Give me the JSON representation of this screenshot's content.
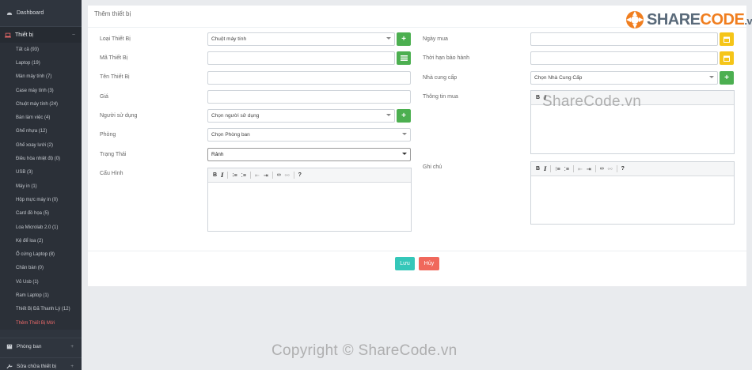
{
  "sidebar": {
    "dashboard": "Dashboard",
    "section": "Thiết bị",
    "items": [
      {
        "label": "Tất cả (93)"
      },
      {
        "label": "Laptop (19)"
      },
      {
        "label": "Màn máy tính (7)"
      },
      {
        "label": "Case máy tính (3)"
      },
      {
        "label": "Chuột máy tính (24)"
      },
      {
        "label": "Bàn làm việc (4)"
      },
      {
        "label": "Ghế nhựa (12)"
      },
      {
        "label": "Ghế xoay lưới (2)"
      },
      {
        "label": "Điều hòa nhiệt độ (0)"
      },
      {
        "label": "USB (3)"
      },
      {
        "label": "Máy in (1)"
      },
      {
        "label": "Hộp mực máy in (0)"
      },
      {
        "label": "Card đồ họa (5)"
      },
      {
        "label": "Loa Microlab 2.0 (1)"
      },
      {
        "label": "Kệ để loa (2)"
      },
      {
        "label": "Ổ cứng Laptop (8)"
      },
      {
        "label": "Chân bàn (0)"
      },
      {
        "label": "Vỏ Usb (1)"
      },
      {
        "label": "Ram Laptop (1)"
      },
      {
        "label": "Thiết Bị Đã Thanh Lý (12)"
      },
      {
        "label": "Thêm Thiết Bị Mới"
      }
    ],
    "footer": [
      {
        "label": "Phòng ban"
      },
      {
        "label": "Sửa chữa thiết bị"
      }
    ]
  },
  "form": {
    "title": "Thêm thiết bị",
    "loai_label": "Loại Thiết Bị",
    "loai_value": "Chuột máy tính",
    "ma_label": "Mã Thiết Bị",
    "ten_label": "Tên Thiết Bị",
    "gia_label": "Giá",
    "nguoi_label": "Người sử dụng",
    "nguoi_value": "Chọn người sử dụng",
    "phong_label": "Phòng",
    "phong_value": "Chọn Phòng ban",
    "trangthai_label": "Trạng Thái",
    "trangthai_value": "Rảnh",
    "cauhinh_label": "Cấu Hình",
    "ngaymua_label": "Ngày mua",
    "baohanh_label": "Thời hạn bảo hành",
    "ncc_label": "Nhà cung cấp",
    "ncc_value": "Chọn Nhà Cung Cấp",
    "thongtin_label": "Thông tin mua",
    "ghichu_label": "Ghi chú",
    "save": "Lưu",
    "cancel": "Hủy"
  },
  "editor_toolbar": {
    "bold": "B",
    "italic": "I",
    "help": "?"
  },
  "watermark": {
    "logo_share": "SHARE",
    "logo_code": "CODE",
    "logo_vn": ".vn",
    "center": "ShareCode.vn",
    "bottom": "Copyright © ShareCode.vn"
  },
  "colors": {
    "sidebar": "#2f353e",
    "green": "#4caf50",
    "yellow": "#f5c518",
    "save": "#35c7b9",
    "cancel": "#f0685c",
    "active": "#ef6a6a"
  }
}
